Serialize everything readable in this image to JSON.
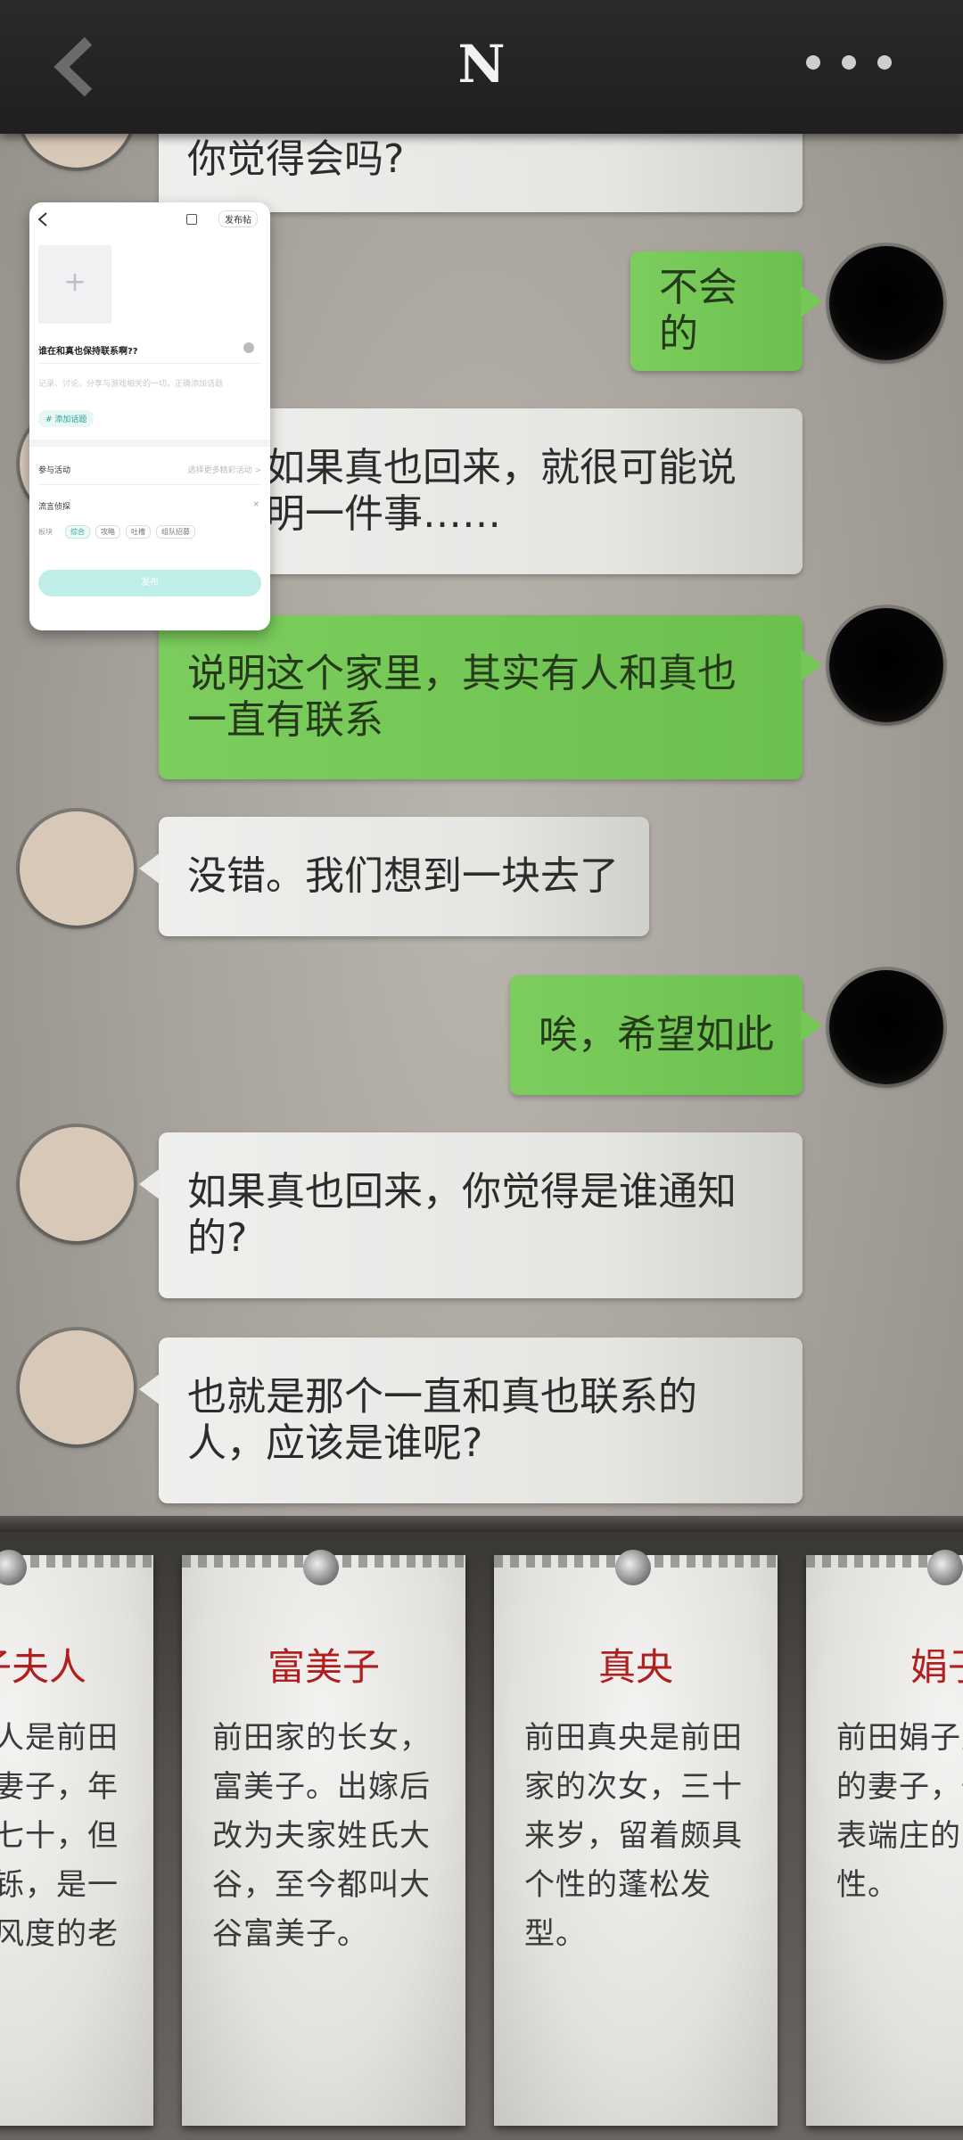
{
  "header": {
    "title": "N"
  },
  "messages": [
    {
      "side": "left",
      "text": "你觉得会吗?"
    },
    {
      "side": "right",
      "text": "不会的"
    },
    {
      "side": "left",
      "text": "如果真也回来，就很可能说明一件事……"
    },
    {
      "side": "right",
      "text": "说明这个家里，其实有人和真也一直有联系"
    },
    {
      "side": "left",
      "text": "没错。我们想到一块去了"
    },
    {
      "side": "right",
      "text": "唉，希望如此"
    },
    {
      "side": "left",
      "text": "如果真也回来，你觉得是谁通知的?"
    },
    {
      "side": "left",
      "text": "也就是那个一直和真也联系的人，应该是谁呢?"
    }
  ],
  "overlay": {
    "tag": "发布帖",
    "add_symbol": "+",
    "title": "谁在和真也保持联系啊??",
    "hint": "记录、讨论、分享与游戏相关的一切，正确添加话题",
    "topic": "# 添加话题",
    "activity": "参与活动",
    "activity_hint": "选择更多精彩活动 >",
    "game": "流言侦探",
    "category_label": "板块",
    "chips": [
      "综合",
      "攻略",
      "吐槽",
      "组队招募"
    ],
    "publish": "发布"
  },
  "cards": [
    {
      "name": "富子夫人",
      "desc": "富子夫人是前田哲平的妻子，年纪大约七十，但精神矍铄，是一位颇具风度的老教授。"
    },
    {
      "name": "富美子",
      "desc": "前田家的长女，富美子。出嫁后改为夫家姓氏大谷，至今都叫大谷富美子。"
    },
    {
      "name": "真央",
      "desc": "前田真央是前田家的次女，三十来岁，留着颇具个性的蓬松发型。"
    },
    {
      "name": "娟子",
      "desc": "前田娟子是启介的妻子，一位外表端庄的家庭女性。"
    }
  ],
  "colors": {
    "green_bubble": "#6cc04e",
    "card_name": "#b01e1e",
    "topbar": "#1f1f1f"
  }
}
